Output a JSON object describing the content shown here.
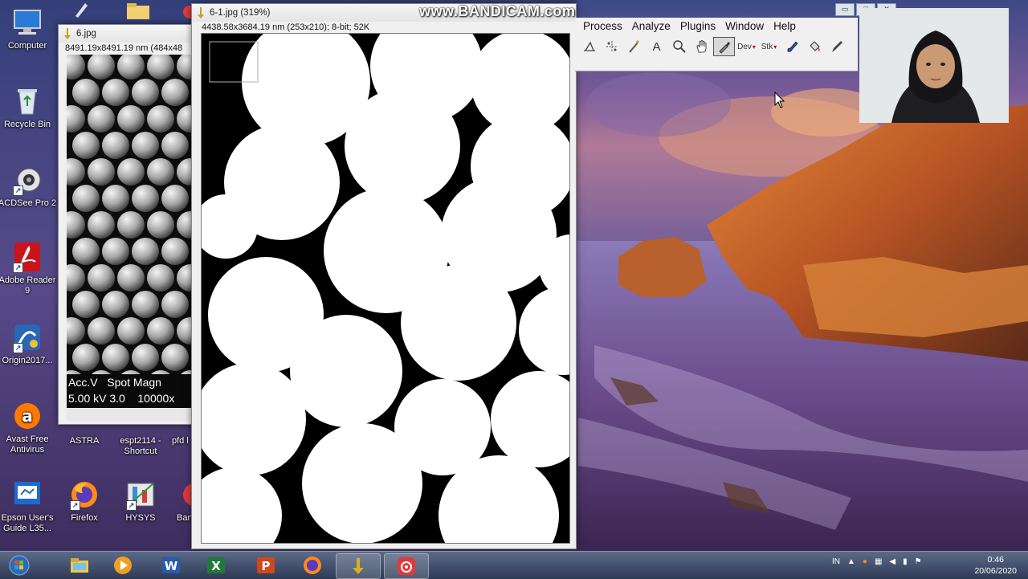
{
  "recording_watermark": "www.BANDICAM.com",
  "desktop": {
    "icons": [
      {
        "label": "Computer"
      },
      {
        "label": "Recycle Bin"
      },
      {
        "label": "ACDSee Pro 2"
      },
      {
        "label": "Adobe Reader 9"
      },
      {
        "label": "Origin2017..."
      },
      {
        "label": "Avast Free Antivirus"
      },
      {
        "label": "ASTRA"
      },
      {
        "label": "espt2114 - Shortcut"
      },
      {
        "label": "pfd l"
      },
      {
        "label": "Epson User's Guide L35..."
      },
      {
        "label": "Firefox"
      },
      {
        "label": "HYSYS"
      },
      {
        "label": "Ban"
      }
    ]
  },
  "sem_window": {
    "title": "6.jpg",
    "info": "8491.19x8491.19 nm (484x48",
    "caption_line1": "Acc.V   Spot Magn",
    "caption_line2": "5.00 kV 3.0    10000x"
  },
  "binary_window": {
    "title": "6-1.jpg (319%)",
    "info": "4438.58x3684.19 nm (253x210); 8-bit; 52K"
  },
  "imagej": {
    "menu": [
      "Process",
      "Analyze",
      "Plugins",
      "Window",
      "Help"
    ],
    "tools": [
      {
        "icon": "line-tool-icon",
        "label": ""
      },
      {
        "icon": "multipoint-tool-icon",
        "label": ""
      },
      {
        "icon": "wand-tool-icon",
        "label": ""
      },
      {
        "icon": "text-tool-icon",
        "label": "A"
      },
      {
        "icon": "magnifier-tool-icon",
        "label": ""
      },
      {
        "icon": "hand-tool-icon",
        "label": ""
      },
      {
        "icon": "color-picker-tool-icon",
        "label": ""
      },
      {
        "icon": "dev-menu-icon",
        "label": "Dev"
      },
      {
        "icon": "stacks-menu-icon",
        "label": "Stk"
      },
      {
        "icon": "brush-tool-icon",
        "label": ""
      },
      {
        "icon": "flood-fill-tool-icon",
        "label": ""
      },
      {
        "icon": "pencil-tool-icon",
        "label": ""
      }
    ]
  },
  "taskbar": {
    "apps": [
      "start-button",
      "file-explorer",
      "media-player",
      "microsoft-word",
      "microsoft-excel",
      "microsoft-powerpoint",
      "firefox",
      "imagej",
      "bandicam"
    ],
    "tray_language": "IN",
    "clock_time": "0:46",
    "clock_date": "20/06/2020"
  },
  "colors": {
    "binary_foreground": "#ffffff",
    "binary_background": "#000000",
    "wallpaper_rock": "#c8622a",
    "wallpaper_sky": "#5b5a9a"
  }
}
